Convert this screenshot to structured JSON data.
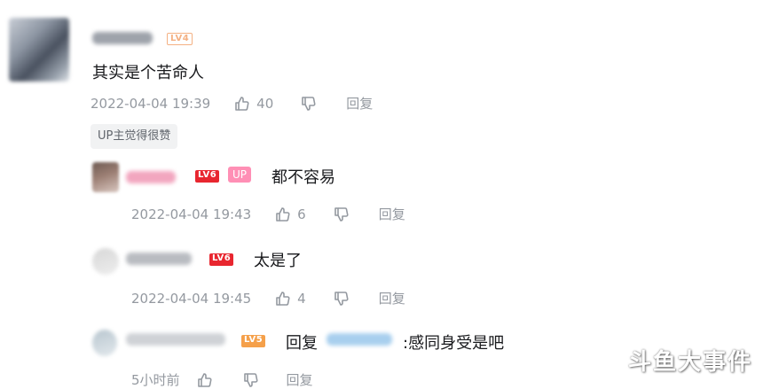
{
  "comment": {
    "level_badge": "LV4",
    "text": "其实是个苦命人",
    "time": "2022-04-04 19:39",
    "likes": "40",
    "reply_label": "回复",
    "up_liked_tag": "UP主觉得很赞"
  },
  "replies": [
    {
      "level_badge": "LV6",
      "up_badge": "UP",
      "text": "都不容易",
      "time": "2022-04-04 19:43",
      "likes": "6",
      "reply_label": "回复"
    },
    {
      "level_badge": "LV6",
      "text": "太是了",
      "time": "2022-04-04 19:45",
      "likes": "4",
      "reply_label": "回复"
    },
    {
      "level_badge": "LV5",
      "reply_prefix": "回复",
      "text": ":感同身受是吧",
      "time": "5小时前",
      "reply_label": "回复"
    }
  ],
  "watermark": "斗鱼大事件",
  "colors": {
    "text": "#18191c",
    "meta": "#9499a0",
    "lv6": "#e8262f",
    "lv5": "#f5a04a",
    "up_badge": "#ff8fb5"
  },
  "icons": [
    "thumb-up-icon",
    "thumb-down-icon"
  ]
}
